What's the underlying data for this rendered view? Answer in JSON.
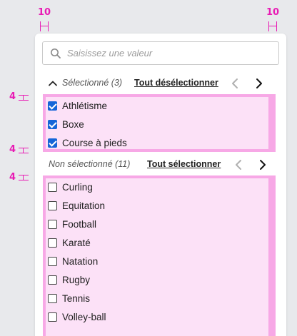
{
  "spec": {
    "left_gap": "10",
    "right_gap": "10",
    "gap_top": "4",
    "gap_mid": "4",
    "gap_low": "4"
  },
  "search": {
    "placeholder": "Saisissez une valeur",
    "value": "",
    "icon": "search-icon"
  },
  "selected_section": {
    "title": "Sélectionné (3)",
    "action": "Tout désélectionner",
    "icon": "chevron-up-icon",
    "items": [
      {
        "label": "Athlétisme",
        "checked": true
      },
      {
        "label": "Boxe",
        "checked": true
      },
      {
        "label": "Course à pieds",
        "checked": true
      }
    ]
  },
  "unselected_section": {
    "title": "Non sélectionné (11)",
    "action": "Tout sélectionner",
    "items": [
      {
        "label": "Curling",
        "checked": false
      },
      {
        "label": "Equitation",
        "checked": false
      },
      {
        "label": "Football",
        "checked": false
      },
      {
        "label": "Karaté",
        "checked": false
      },
      {
        "label": "Natation",
        "checked": false
      },
      {
        "label": "Rugby",
        "checked": false
      },
      {
        "label": "Tennis",
        "checked": false
      },
      {
        "label": "Volley-ball",
        "checked": false
      }
    ]
  },
  "colors": {
    "accent": "#1565d8",
    "spec_magenta": "#e81bb4",
    "spec_pink": "#f7a8e6"
  }
}
